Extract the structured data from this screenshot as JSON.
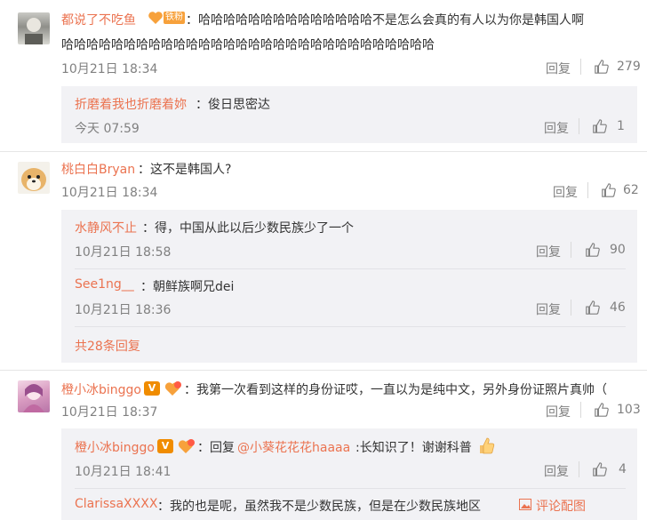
{
  "comments": [
    {
      "user": "都说了不吃鱼",
      "fan_badge": "铁粉",
      "text": "：哈哈哈哈哈哈哈哈哈哈哈哈哈哈不是怎么会真的有人以为你是韩国人啊",
      "text_line2": "哈哈哈哈哈哈哈哈哈哈哈哈哈哈哈哈哈哈哈哈哈哈哈哈哈哈哈哈哈哈",
      "time": "10月21日 18:34",
      "reply_label": "回复",
      "likes": "279",
      "replies": [
        {
          "user": "折磨着我也折磨着妳",
          "text": "：俊日思密达",
          "time": "今天 07:59",
          "reply_label": "回复",
          "likes": "1"
        }
      ]
    },
    {
      "user": "桃白白Bryan",
      "text": "：这不是韩国人?",
      "time": "10月21日 18:34",
      "reply_label": "回复",
      "likes": "62",
      "replies": [
        {
          "user": "水静风不止",
          "text": "：得，中国从此以后少数民族少了一个",
          "time": "10月21日 18:58",
          "reply_label": "回复",
          "likes": "90"
        },
        {
          "user": "See1ng__",
          "text": "：朝鲜族啊兄dei",
          "time": "10月21日 18:36",
          "reply_label": "回复",
          "likes": "46"
        }
      ],
      "more_replies": "共28条回复"
    },
    {
      "user": "橙小冰binggo",
      "text": "：我第一次看到这样的身份证哎，一直以为是纯中文，另外身份证照片真帅（",
      "time": "10月21日 18:37",
      "reply_label": "回复",
      "likes": "103",
      "replies": [
        {
          "user": "橙小冰binggo",
          "text_prefix": "：回复",
          "mention": "@小葵花花花haaaa",
          "text": ":长知识了！谢谢科普",
          "time": "10月21日 18:41",
          "reply_label": "回复",
          "likes": "4"
        },
        {
          "user": "ClarissaXXXX",
          "text": "：我的也是呢，虽然我不是少数民族，但是在少数民族地区",
          "image_link": "评论配图"
        }
      ]
    }
  ],
  "colors": {
    "name": "#eb7350",
    "muted": "#808080",
    "sub_bg": "#f2f2f5"
  },
  "icons": [
    "thumb-up-icon",
    "verified-v-icon",
    "fan-badge-icon",
    "image-icon",
    "thumbs-up-emoji"
  ]
}
